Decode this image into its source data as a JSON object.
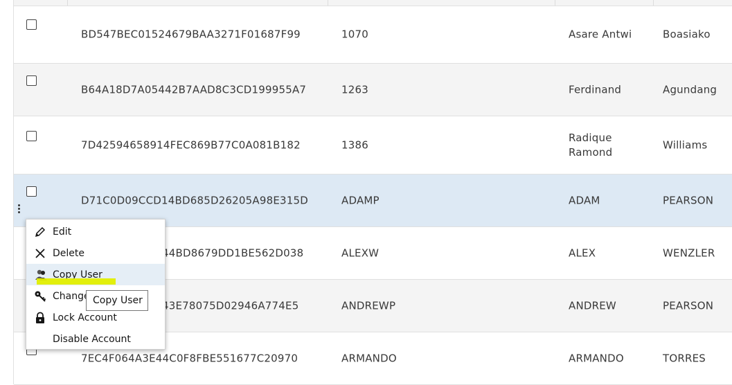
{
  "table": {
    "rows": [
      {
        "id": "BD547BEC01524679BAA3271F01687F99",
        "username": "1070",
        "first": "Asare Antwi",
        "last": "Boasiako"
      },
      {
        "id": "B64A18D7A05442B7AAD8C3CD199955A7",
        "username": "1263",
        "first": "Ferdinand",
        "last": "Agundang"
      },
      {
        "id": "7D42594658914FEC869B77C0A081B182",
        "username": "1386",
        "first": "Radique Ramond",
        "last": "Williams"
      },
      {
        "id": "D71C0D09CCD14BD685D26205A98E315D",
        "username": "ADAMP",
        "first": "ADAM",
        "last": "PEARSON"
      },
      {
        "id": "44BD8679DD1BE562D038",
        "username": "ALEXW",
        "first": "ALEX",
        "last": "WENZLER"
      },
      {
        "id": "43E78075D02946A774E5",
        "username": "ANDREWP",
        "first": "ANDREW",
        "last": "PEARSON"
      },
      {
        "id": "7EC4F064A3E44C0F8FBE551677C20970",
        "username": "ARMANDO",
        "first": "ARMANDO",
        "last": "TORRES"
      }
    ]
  },
  "context_menu": {
    "items": [
      {
        "label": "Edit",
        "icon": "pencil-icon"
      },
      {
        "label": "Delete",
        "icon": "close-icon"
      },
      {
        "label": "Copy User",
        "icon": "copy-user-icon"
      },
      {
        "label": "Change",
        "icon": "key-icon"
      },
      {
        "label": "Lock Account",
        "icon": "lock-icon"
      },
      {
        "label": "Disable Account",
        "icon": ""
      }
    ]
  },
  "tooltip": {
    "text": "Copy User"
  },
  "colors": {
    "selected_row": "#dde9f4",
    "alt_row": "#f4f4f4",
    "highlight": "#e2ee00"
  }
}
